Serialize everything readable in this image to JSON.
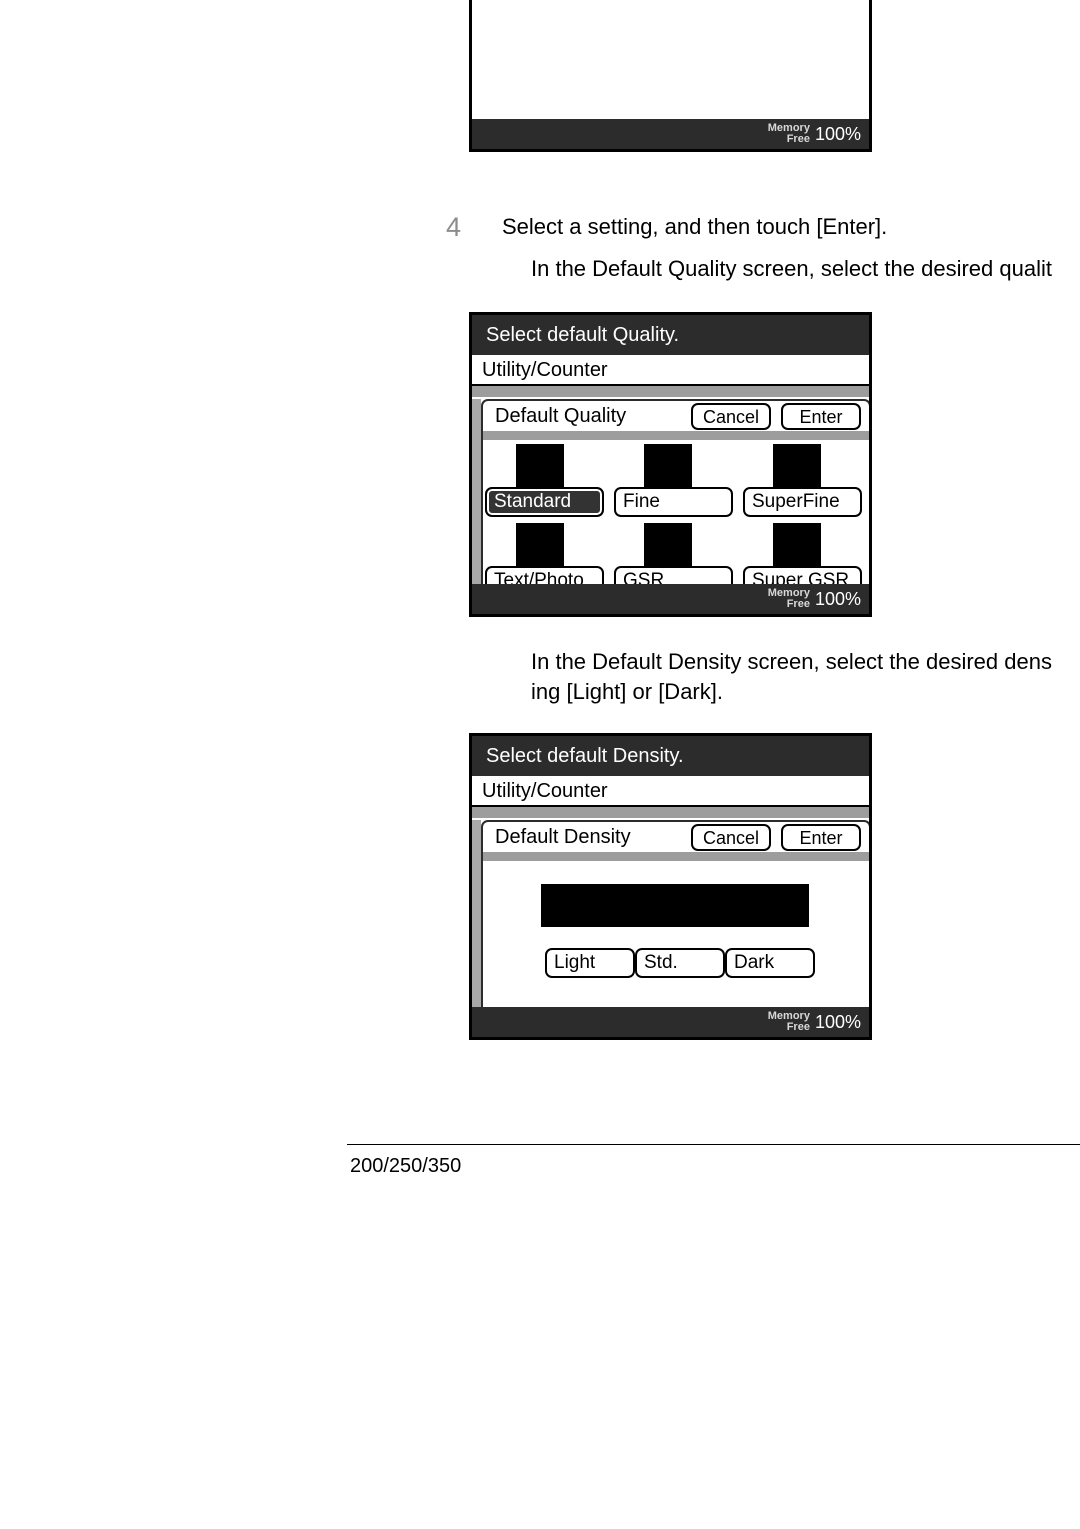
{
  "page": {
    "step_number": "4",
    "step_instruction": "Select a setting, and then touch [Enter].",
    "quality_note": "In the Default Quality screen, select the desired qualit",
    "density_note_line1": "In the Default Density screen, select the desired dens",
    "density_note_line2": "ing [Light] or [Dark].",
    "footer_model": "200/250/350"
  },
  "colors": {
    "panel_border": "#000000",
    "titlebar_bg": "#2c2c2c",
    "grey_band": "#9d9d9d",
    "selected_bg": "#333333",
    "step_number": "#8c8c8c"
  },
  "panel_partial": {
    "memory": {
      "label_line1": "Memory",
      "label_line2": "Free",
      "value": "100%"
    }
  },
  "panel_quality": {
    "titlebar": "Select default Quality.",
    "subbar": "Utility/Counter",
    "dialog_title": "Default Quality",
    "cancel_label": "Cancel",
    "enter_label": "Enter",
    "options": [
      {
        "label": "Standard",
        "selected": true,
        "icon": "quality-preview-swatch"
      },
      {
        "label": "Fine",
        "selected": false,
        "icon": "quality-preview-swatch"
      },
      {
        "label": "SuperFine",
        "selected": false,
        "icon": "quality-preview-swatch"
      },
      {
        "label": "Text/Photo",
        "selected": false,
        "icon": "quality-preview-swatch"
      },
      {
        "label": "GSR",
        "selected": false,
        "icon": "quality-preview-swatch"
      },
      {
        "label": "Super GSR",
        "selected": false,
        "icon": "quality-preview-swatch"
      }
    ],
    "memory": {
      "label_line1": "Memory",
      "label_line2": "Free",
      "value": "100%"
    }
  },
  "panel_density": {
    "titlebar": "Select default Density.",
    "subbar": "Utility/Counter",
    "dialog_title": "Default Density",
    "cancel_label": "Cancel",
    "enter_label": "Enter",
    "preview_icon": "density-preview-bar",
    "options": [
      {
        "label": "Light"
      },
      {
        "label": "Std."
      },
      {
        "label": "Dark"
      }
    ],
    "memory": {
      "label_line1": "Memory",
      "label_line2": "Free",
      "value": "100%"
    }
  }
}
